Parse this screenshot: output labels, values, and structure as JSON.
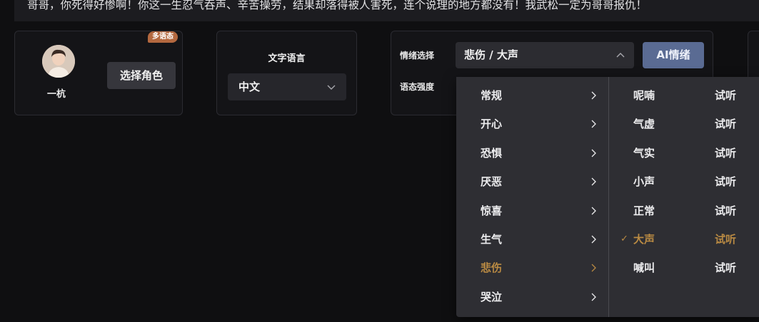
{
  "text_strip": "哥哥，你死得好惨啊！你这一生忍气吞声、辛苦操劳，结果却落得被人害死，连个说理的地方都没有！我武松一定为哥哥报仇！",
  "role": {
    "badge": "多语态",
    "name": "一杭",
    "select_label": "选择角色"
  },
  "language": {
    "title": "文字语言",
    "value": "中文"
  },
  "emotion": {
    "select_label": "情绪选择",
    "intensity_label": "语态强度",
    "value": "悲伤 / 大声",
    "ai_button": "AI情绪"
  },
  "cascader": {
    "categories": [
      {
        "label": "常规",
        "active": false
      },
      {
        "label": "开心",
        "active": false
      },
      {
        "label": "恐惧",
        "active": false
      },
      {
        "label": "厌恶",
        "active": false
      },
      {
        "label": "惊喜",
        "active": false
      },
      {
        "label": "生气",
        "active": false
      },
      {
        "label": "悲伤",
        "active": true
      },
      {
        "label": "哭泣",
        "active": false
      }
    ],
    "styles": [
      {
        "label": "呢喃",
        "play": "试听",
        "selected": false
      },
      {
        "label": "气虚",
        "play": "试听",
        "selected": false
      },
      {
        "label": "气实",
        "play": "试听",
        "selected": false
      },
      {
        "label": "小声",
        "play": "试听",
        "selected": false
      },
      {
        "label": "正常",
        "play": "试听",
        "selected": false
      },
      {
        "label": "大声",
        "play": "试听",
        "selected": true
      },
      {
        "label": "喊叫",
        "play": "试听",
        "selected": false
      }
    ]
  },
  "colors": {
    "accent_active": "#b98a43",
    "ai_button": "#5a6b93",
    "badge": "#b3683f"
  }
}
